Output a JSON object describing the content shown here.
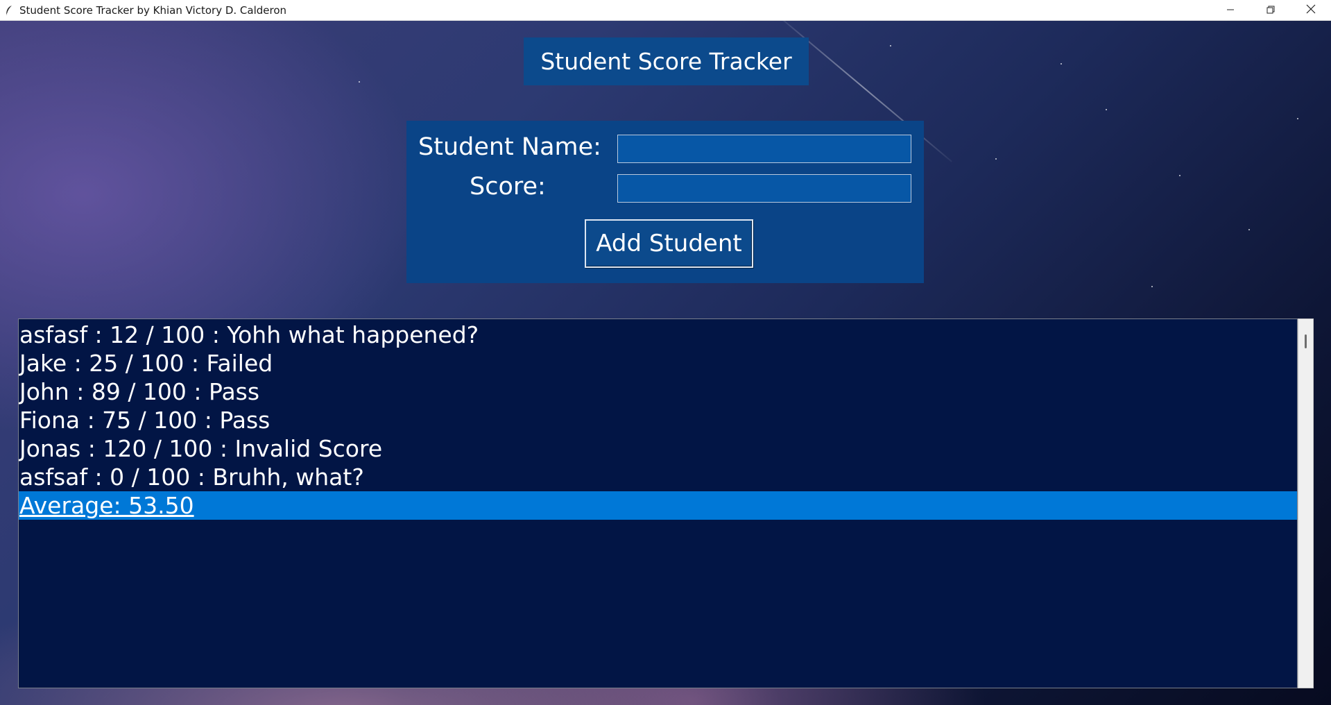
{
  "window": {
    "title": "Student Score Tracker by Khian Victory D. Calderon"
  },
  "app": {
    "heading": "Student Score Tracker",
    "form": {
      "name_label": "Student Name:",
      "name_value": "",
      "score_label": "Score:",
      "score_value": "",
      "add_button_label": "Add Student"
    },
    "list": {
      "items": [
        "asfasf : 12 / 100 : Yohh what happened?",
        "Jake : 25 / 100 : Failed",
        "John : 89 / 100 : Pass",
        "Fiona : 75 / 100 : Pass",
        "Jonas : 120 / 100 : Invalid Score",
        "asfsaf : 0 / 100 : Bruhh, what?",
        "Average: 53.50"
      ],
      "selected_index": 6
    }
  },
  "colors": {
    "panel": "#0a4487",
    "heading_bg": "#0c4a8c",
    "input_bg": "#0757a6",
    "list_bg": "#021545",
    "selection": "#0078d7"
  },
  "icons": {
    "app_icon": "feather-icon",
    "minimize": "minimize-icon",
    "restore": "restore-icon",
    "close": "close-icon"
  }
}
